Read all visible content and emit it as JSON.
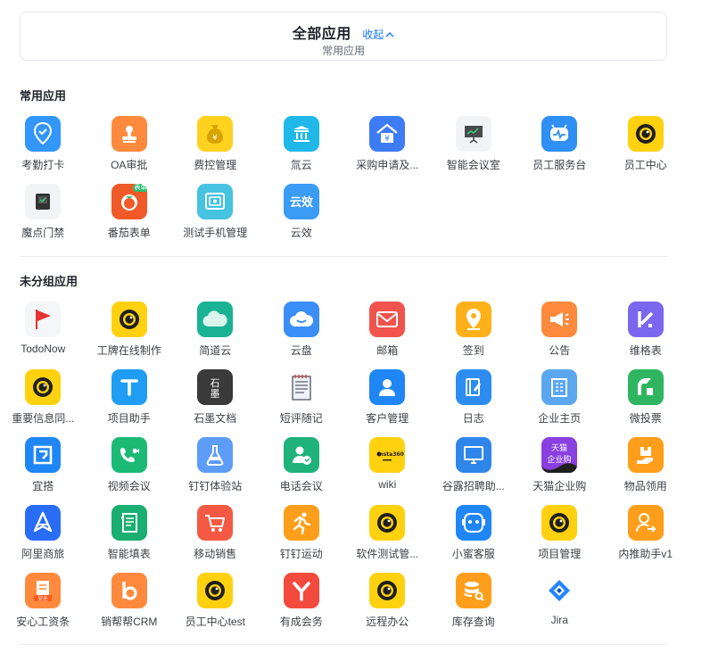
{
  "header": {
    "title": "全部应用",
    "collapse_label": "收起",
    "subtitle": "常用应用"
  },
  "sections": {
    "common": {
      "title": "常用应用",
      "apps": [
        {
          "label": "考勤打卡",
          "icon": "location-check-icon",
          "color": "#3296fa"
        },
        {
          "label": "OA审批",
          "icon": "stamp-icon",
          "color": "#ff8a3d"
        },
        {
          "label": "费控管理",
          "icon": "money-bag-icon",
          "color": "#ffd21f"
        },
        {
          "label": "氚云",
          "icon": "building-icon",
          "color": "#1fb8e8"
        },
        {
          "label": "采购申请及...",
          "icon": "house-yuan-icon",
          "color": "#3d7cf5"
        },
        {
          "label": "智能会议室",
          "icon": "presentation-board-icon",
          "color": "#f2f3f5"
        },
        {
          "label": "员工服务台",
          "icon": "robot-heartbeat-icon",
          "color": "#2f8ff5"
        },
        {
          "label": "员工中心",
          "icon": "eye-ring-icon",
          "color": "#ffd10f"
        },
        {
          "label": "魔点门禁",
          "icon": "door-device-icon",
          "color": "#f2f3f5"
        },
        {
          "label": "番茄表单",
          "icon": "tomato-icon",
          "color": "#f05a28"
        },
        {
          "label": "测试手机管理",
          "icon": "safe-box-icon",
          "color": "#45c3e0"
        },
        {
          "label": "云效",
          "icon": "yunxiao-text-icon",
          "color": "#3b9cf5"
        }
      ]
    },
    "ungrouped": {
      "title": "未分组应用",
      "apps": [
        {
          "label": "TodoNow",
          "icon": "red-flag-icon",
          "color": "#f5f6f7"
        },
        {
          "label": "工牌在线制作",
          "icon": "eye-ring-icon",
          "color": "#ffd10f"
        },
        {
          "label": "简道云",
          "icon": "cloud-icon",
          "color": "#19b394"
        },
        {
          "label": "云盘",
          "icon": "cloud-drive-icon",
          "color": "#3a8ef6"
        },
        {
          "label": "邮箱",
          "icon": "mail-icon",
          "color": "#f0544c"
        },
        {
          "label": "签到",
          "icon": "location-pin-icon",
          "color": "#ffb11a"
        },
        {
          "label": "公告",
          "icon": "megaphone-icon",
          "color": "#ff8a3d"
        },
        {
          "label": "维格表",
          "icon": "vika-icon",
          "color": "#7b67ee"
        },
        {
          "label": "重要信息同...",
          "icon": "eye-ring-icon",
          "color": "#ffd10f"
        },
        {
          "label": "项目助手",
          "icon": "letter-t-icon",
          "color": "#1e9df2"
        },
        {
          "label": "石墨文档",
          "icon": "shimo-icon",
          "color": "#3a3a3a"
        },
        {
          "label": "短评随记",
          "icon": "notepad-icon",
          "color": "#ffffff"
        },
        {
          "label": "客户管理",
          "icon": "person-icon",
          "color": "#1f86f5"
        },
        {
          "label": "日志",
          "icon": "journal-icon",
          "color": "#2d8cf0"
        },
        {
          "label": "企业主页",
          "icon": "building-page-icon",
          "color": "#5aa7f0"
        },
        {
          "label": "微投票",
          "icon": "vote-icon",
          "color": "#2fb55f"
        },
        {
          "label": "宜搭",
          "icon": "yida-icon",
          "color": "#1f86f5"
        },
        {
          "label": "视频会议",
          "icon": "video-phone-icon",
          "color": "#1aba75"
        },
        {
          "label": "钉钉体验站",
          "icon": "flask-icon",
          "color": "#5d9cf7"
        },
        {
          "label": "电话会议",
          "icon": "phone-meeting-icon",
          "color": "#1fb27a"
        },
        {
          "label": "wiki",
          "icon": "wiki-badge-icon",
          "color": "#ffd10f"
        },
        {
          "label": "谷露招聘助...",
          "icon": "monitor-icon",
          "color": "#2f86ea"
        },
        {
          "label": "天猫企业购",
          "icon": "tmall-icon",
          "color": "#8a3fe0"
        },
        {
          "label": "物品领用",
          "icon": "box-hand-icon",
          "color": "#ff9e1a"
        },
        {
          "label": "阿里商旅",
          "icon": "plane-icon",
          "color": "#2a6df5"
        },
        {
          "label": "智能填表",
          "icon": "form-icon",
          "color": "#1aae70"
        },
        {
          "label": "移动销售",
          "icon": "cart-icon",
          "color": "#f45a43"
        },
        {
          "label": "钉钉运动",
          "icon": "runner-icon",
          "color": "#ff9e1a"
        },
        {
          "label": "软件测试管...",
          "icon": "eye-ring-icon",
          "color": "#ffd10f"
        },
        {
          "label": "小蜜客服",
          "icon": "assistant-icon",
          "color": "#1f86f5"
        },
        {
          "label": "项目管理",
          "icon": "eye-ring-icon",
          "color": "#ffd10f"
        },
        {
          "label": "内推助手v1",
          "icon": "person-arrow-icon",
          "color": "#ff9e1a"
        },
        {
          "label": "安心工资条",
          "icon": "salary-icon",
          "color": "#ff8a3d"
        },
        {
          "label": "销帮帮CRM",
          "icon": "letter-b-icon",
          "color": "#ff8a3d"
        },
        {
          "label": "员工中心test",
          "icon": "eye-ring-icon",
          "color": "#ffd10f"
        },
        {
          "label": "有成会务",
          "icon": "letter-y-icon",
          "color": "#f24a3c"
        },
        {
          "label": "远程办公",
          "icon": "eye-ring-icon",
          "color": "#ffd10f"
        },
        {
          "label": "库存查询",
          "icon": "database-search-icon",
          "color": "#ff9e1a"
        },
        {
          "label": "Jira",
          "icon": "jira-icon",
          "color": "#ffffff"
        }
      ]
    }
  },
  "text_on_icons": {
    "shimo": "石墨",
    "wiki_badge": "Insta360",
    "tmall": "天猫企业购",
    "salary_tag": "安全",
    "yunxiao": "云效"
  }
}
